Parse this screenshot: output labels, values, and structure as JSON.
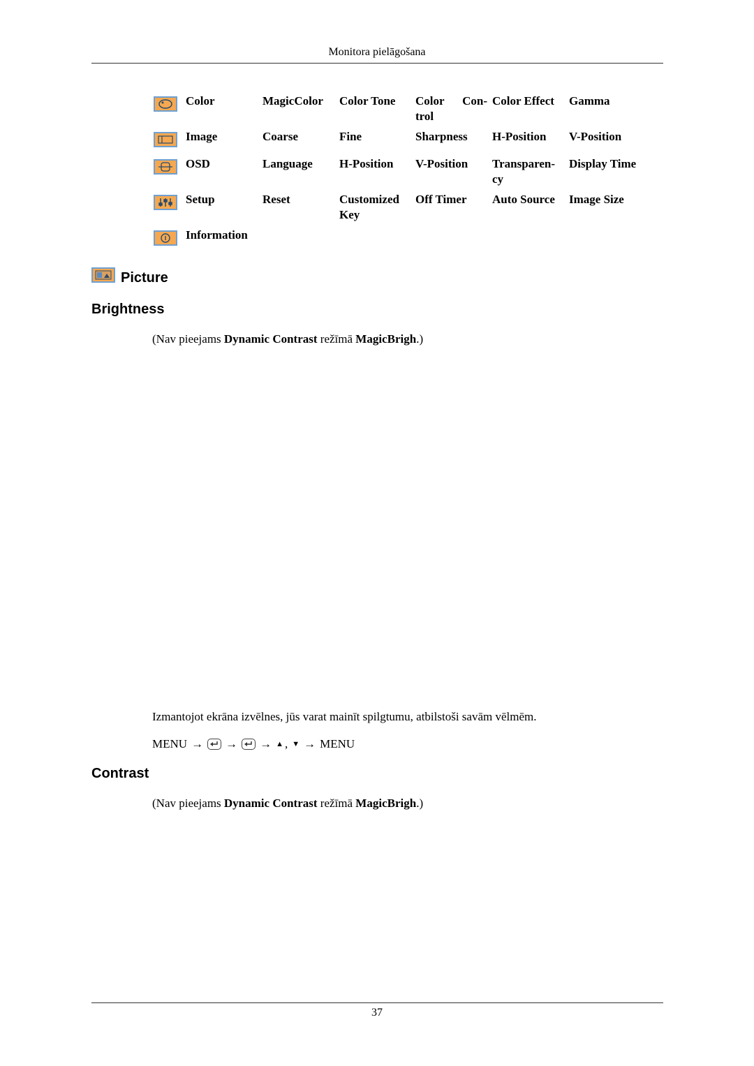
{
  "header": {
    "title": "Monitora pielāgošana"
  },
  "menu_table": {
    "rows": [
      {
        "icon": "color-palette-icon",
        "cells": [
          "Color",
          "MagicColor",
          "Color Tone",
          "Color Con-trol",
          "Color Effect",
          "Gamma"
        ],
        "cell3_parts": [
          "Color",
          "Con-",
          "trol"
        ]
      },
      {
        "icon": "image-icon",
        "cells": [
          "Image",
          "Coarse",
          "Fine",
          "Sharpness",
          "H-Position",
          "V-Position"
        ]
      },
      {
        "icon": "osd-icon",
        "cells": [
          "OSD",
          "Language",
          "H-Position",
          "V-Position",
          "Transparen-cy",
          "Display Time"
        ],
        "cell4_parts": [
          "Transparen-",
          "cy"
        ]
      },
      {
        "icon": "setup-icon",
        "cells": [
          "Setup",
          "Reset",
          "Customized Key",
          "Off Timer",
          "Auto Source",
          "Image Size"
        ],
        "cell2_parts": [
          "Customized",
          "Key"
        ]
      },
      {
        "icon": "information-icon",
        "cells": [
          "Information"
        ]
      }
    ]
  },
  "picture_section": {
    "title": "Picture",
    "brightness": {
      "title": "Brightness",
      "note": {
        "prefix": "(Nav pieejams ",
        "bold1": "Dynamic Contrast",
        "middle": " režīmā ",
        "bold2": "MagicBrigh",
        "suffix": ".)"
      },
      "description": "Izmantojot ekrāna izvēlnes, jūs varat mainīt spilgtumu, atbilstoši savām vēlmēm.",
      "sequence": {
        "start": "MENU",
        "arrow": "→",
        "up": "▲",
        "comma": ",",
        "down": "▼",
        "end": "MENU"
      }
    },
    "contrast": {
      "title": "Contrast",
      "note": {
        "prefix": "(Nav pieejams ",
        "bold1": "Dynamic Contrast",
        "middle": " režīmā ",
        "bold2": "MagicBrigh",
        "suffix": ".)"
      }
    }
  },
  "footer": {
    "page_number": "37"
  }
}
